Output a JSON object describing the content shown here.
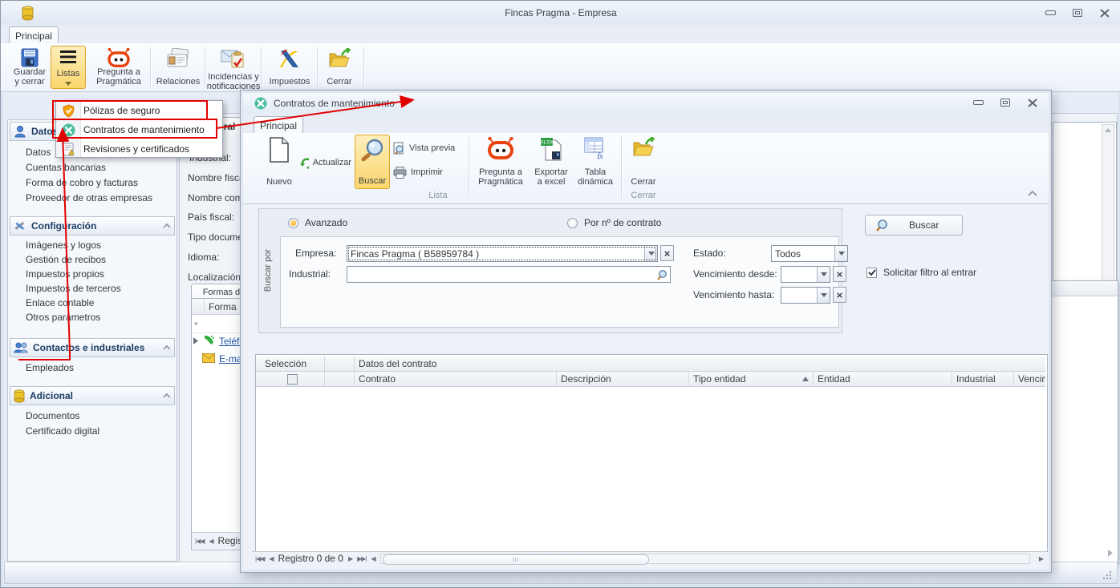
{
  "colors": {
    "selection_orange": "#fbd66d",
    "annotation_red": "#e10000",
    "link_blue": "#1a55a8"
  },
  "icons": {
    "app-icon": "yellow-cylinder",
    "close-icon": "x-cross",
    "minimize-icon": "dash",
    "maximize-icon": "squares",
    "collapse-ribbon-icon": "chevron-up",
    "listas-icon": "hamburger-lines",
    "pragmatica-icon": "orange-robot",
    "search-icon": "magnifier",
    "refresh-icon": "green-arrows",
    "folder-exit-icon": "folder-green-arrow",
    "shield-icon": "orange-shield",
    "tools-icon": "green-circle-tools",
    "bell-clipboard-icon": "clipboard-bell"
  },
  "main": {
    "title": "Fincas Pragma - Empresa",
    "tab": "Principal",
    "ribbon": {
      "buttons": [
        "Guardar y cerrar",
        "Listas",
        "Pregunta a Pragmática",
        "Relaciones",
        "Incidencias y notificaciones",
        "Impuestos",
        "Cerrar"
      ]
    }
  },
  "menu": {
    "items": [
      {
        "label": "Pólizas de seguro"
      },
      {
        "label": "Contratos de mantenimiento"
      },
      {
        "label": "Revisiones y certificados"
      }
    ]
  },
  "sidebar": {
    "sections": [
      {
        "title": "Datos",
        "items": [
          "Datos",
          "Cuentas bancarias",
          "Forma de cobro y facturas",
          "Proveedor de otras empresas"
        ]
      },
      {
        "title": "Configuración",
        "items": [
          "Imágenes y logos",
          "Gestión de recibos",
          "Impuestos propios",
          "Impuestos de terceros",
          "Enlace contable",
          "Otros parámetros"
        ]
      },
      {
        "title": "Contactos e industriales",
        "items": [
          "Empleados"
        ]
      },
      {
        "title": "Adicional",
        "items": [
          "Documentos",
          "Certificado digital"
        ]
      }
    ]
  },
  "form": {
    "tab": "General",
    "labels": [
      "Industrial:",
      "Nombre fiscal:",
      "Nombre comercial:",
      "Tipo documento:",
      "País fiscal:",
      "Idioma:",
      "Localización:"
    ],
    "formas": {
      "tab": "Formas de cobro",
      "col": "Forma",
      "new_row": "*",
      "rows": [
        "Teléfono",
        "E-mail"
      ],
      "nav": "Registro"
    }
  },
  "child": {
    "title": "Contratos de mantenimiento",
    "tab": "Principal",
    "ribbon": {
      "nuevo": "Nuevo",
      "actualizar": "Actualizar",
      "buscar": "Buscar",
      "vista_previa": "Vista previa",
      "imprimir": "Imprimir",
      "pregunta": "Pregunta a Pragmática",
      "exportar": "Exportar a excel",
      "tabla": "Tabla dinámica",
      "cerrar": "Cerrar",
      "group_lista": "Lista",
      "group_cerrar": "Cerrar"
    },
    "search": {
      "panel_label": "Buscar por",
      "radio_avanzado": "Avanzado",
      "radio_contrato": "Por nº de contrato",
      "empresa_label": "Empresa:",
      "empresa_value": "Fincas Pragma ( B58959784 )",
      "industrial_label": "Industrial:",
      "estado_label": "Estado:",
      "estado_value": "Todos",
      "venc_desde_label": "Vencimiento desde:",
      "venc_hasta_label": "Vencimiento hasta:",
      "buscar_button": "Buscar",
      "filtro_checkbox": "Solicitar filtro al entrar"
    },
    "grid": {
      "sel_col": "Selección",
      "group_col": "Datos del contrato",
      "cols": [
        "Contrato",
        "Descripción",
        "Tipo entidad",
        "Entidad",
        "Industrial",
        "Vencimiento"
      ]
    },
    "status": {
      "registro": "Registro 0 de 0"
    }
  }
}
